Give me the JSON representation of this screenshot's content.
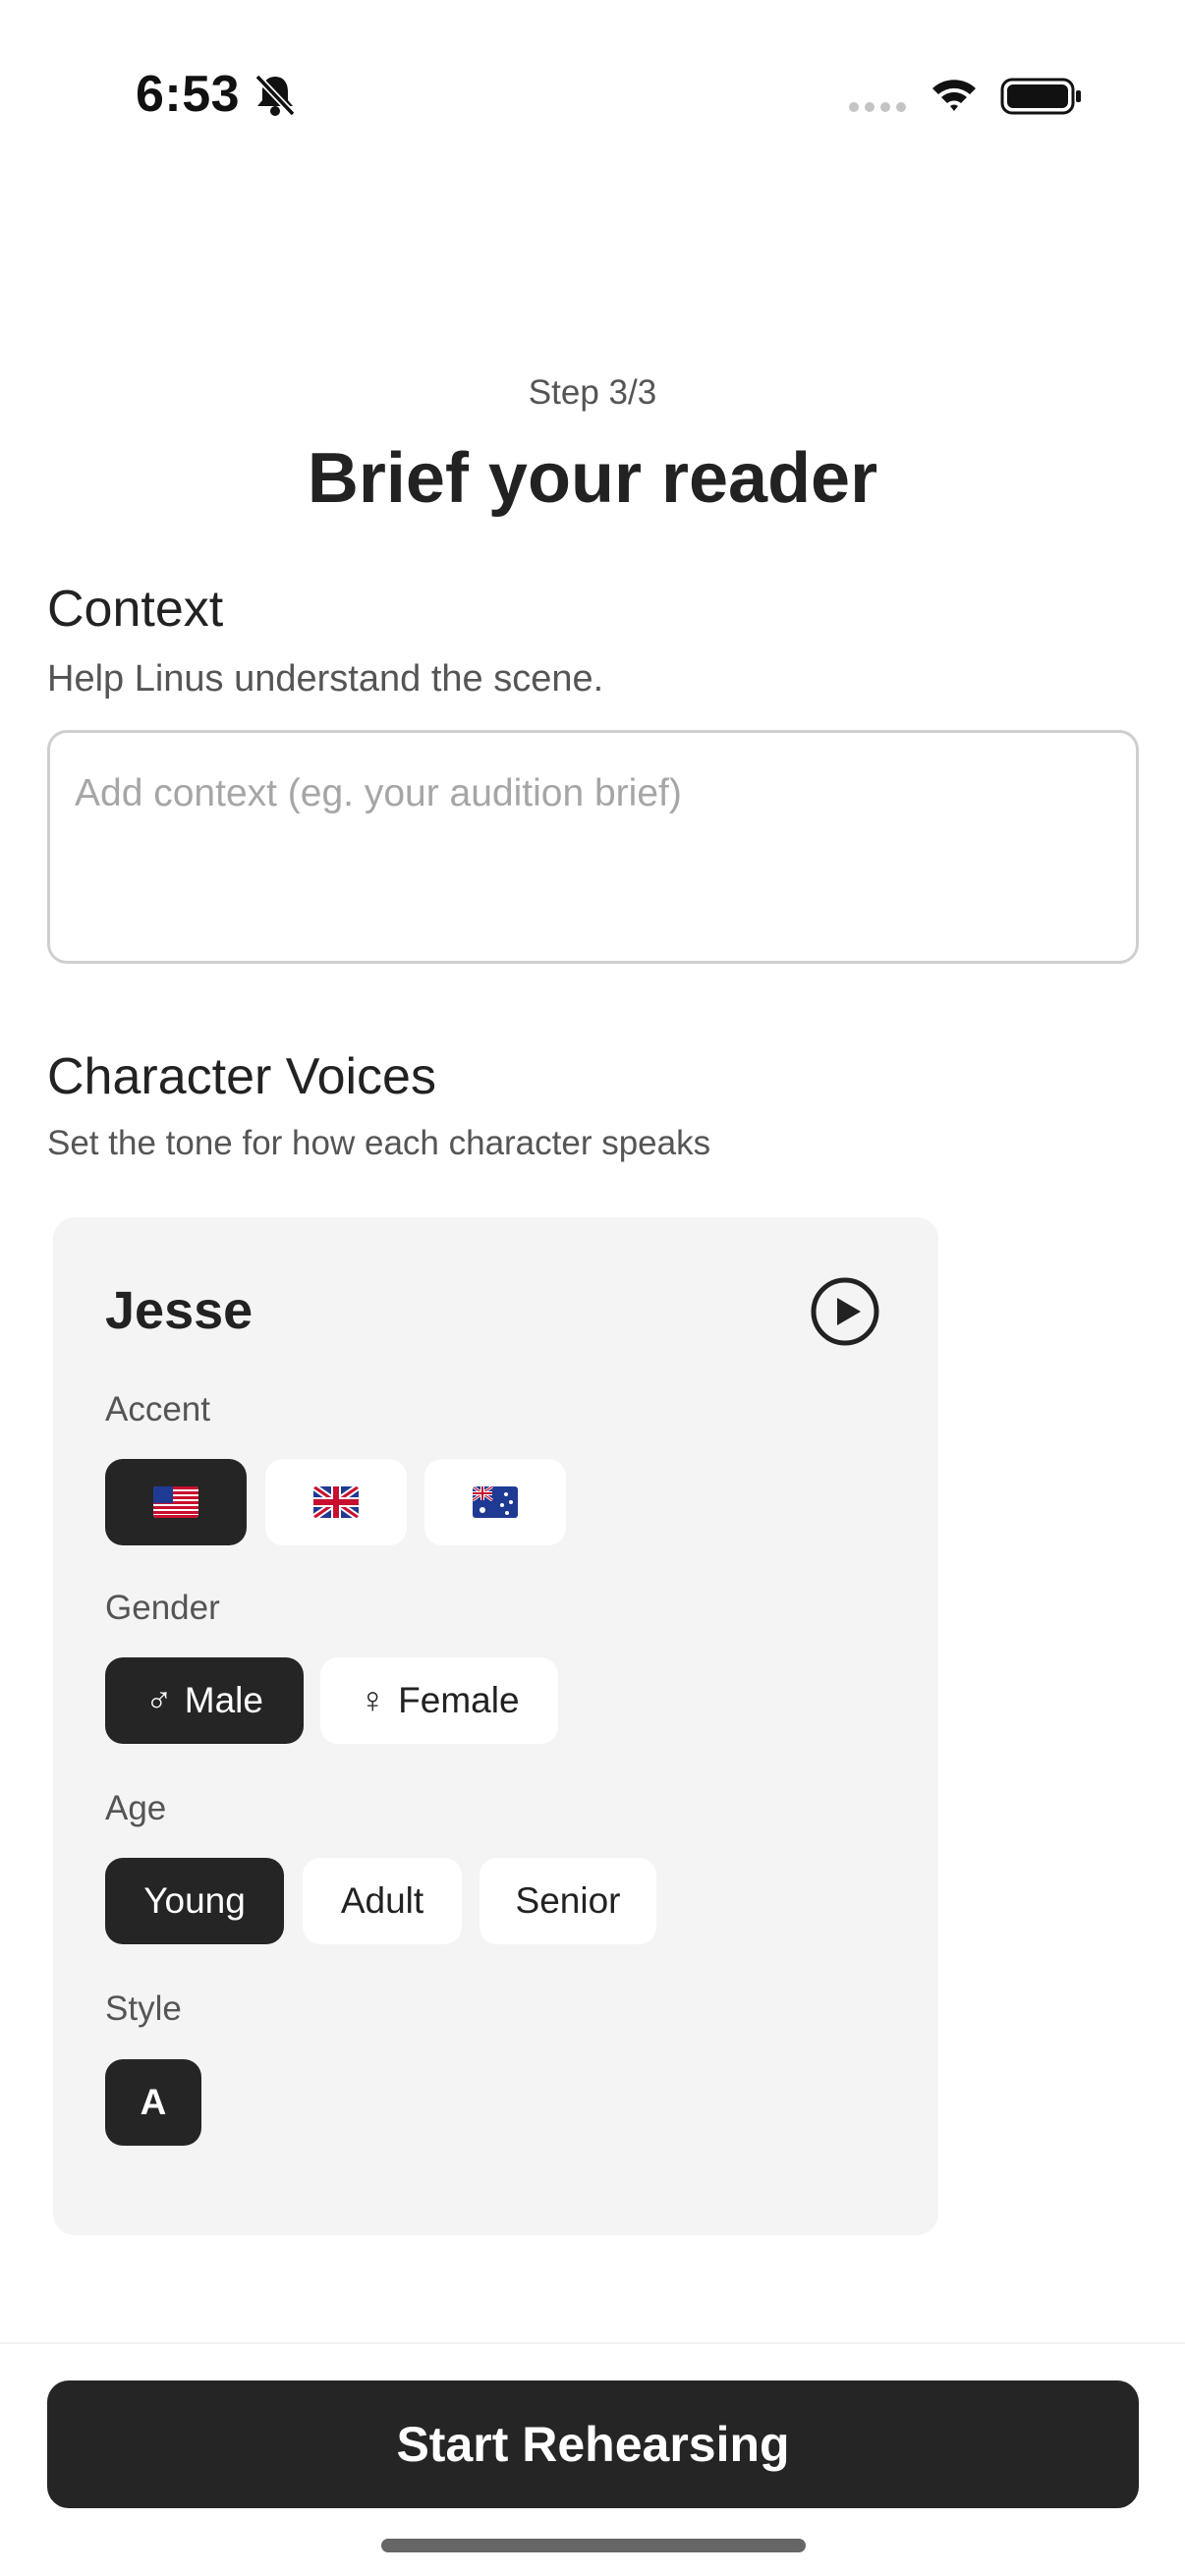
{
  "status_bar": {
    "time": "6:53",
    "icons": [
      "bell-slash-icon",
      "signal-dots-icon",
      "wifi-icon",
      "battery-icon"
    ]
  },
  "header": {
    "step": "Step 3/3",
    "title": "Brief your reader"
  },
  "context": {
    "heading": "Context",
    "subtitle": "Help Linus understand the scene.",
    "input_value": "",
    "input_placeholder": "Add context (eg. your audition brief)"
  },
  "character_voices": {
    "heading": "Character Voices",
    "subtitle": "Set the tone for how each character speaks",
    "characters": [
      {
        "name": "Jesse",
        "play_icon": "play-circle-icon",
        "accent": {
          "label": "Accent",
          "options": [
            {
              "flag": "us-flag-icon",
              "selected": true
            },
            {
              "flag": "uk-flag-icon",
              "selected": false
            },
            {
              "flag": "au-flag-icon",
              "selected": false
            }
          ]
        },
        "gender": {
          "label": "Gender",
          "options": [
            {
              "symbol": "♂",
              "text": "Male",
              "selected": true
            },
            {
              "symbol": "♀",
              "text": "Female",
              "selected": false
            }
          ]
        },
        "age": {
          "label": "Age",
          "options": [
            {
              "text": "Young",
              "selected": true
            },
            {
              "text": "Adult",
              "selected": false
            },
            {
              "text": "Senior",
              "selected": false
            }
          ]
        },
        "style": {
          "label": "Style",
          "options": [
            {
              "text": "A",
              "selected": true
            }
          ]
        }
      }
    ]
  },
  "footer": {
    "start_label": "Start Rehearsing"
  },
  "colors": {
    "selected_chip": "#252525",
    "card_background": "#f4f4f4",
    "primary_button": "#252525"
  }
}
